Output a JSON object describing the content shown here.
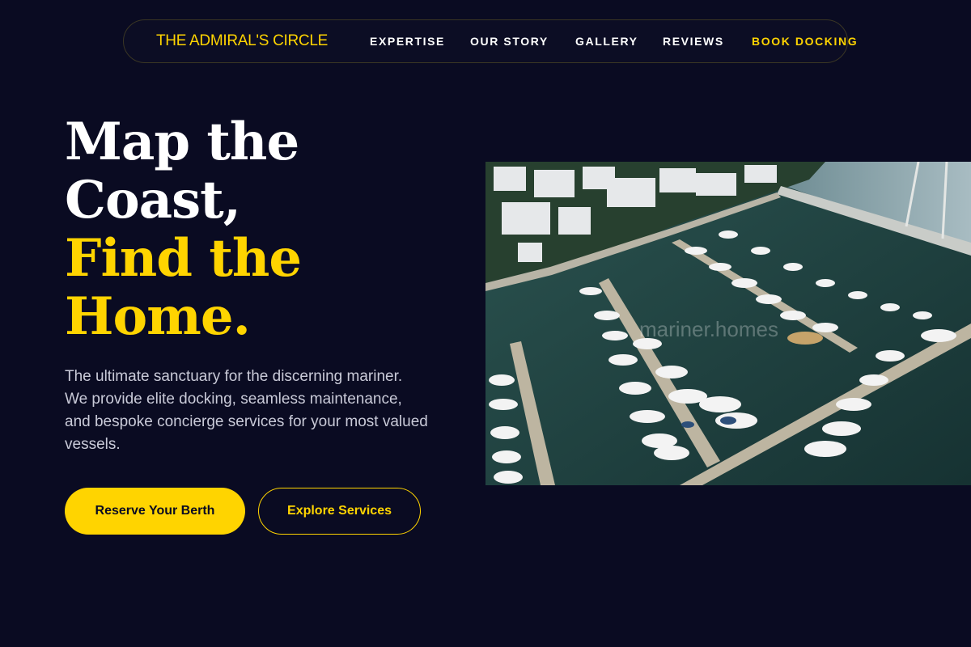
{
  "brand": {
    "name": "THE ADMIRAL'S CIRCLE"
  },
  "nav": {
    "links": [
      {
        "label": "EXPERTISE"
      },
      {
        "label": "OUR STORY"
      },
      {
        "label": "GALLERY"
      },
      {
        "label": "REVIEWS"
      },
      {
        "label": "BOOK DOCKING"
      }
    ]
  },
  "hero": {
    "title_lines": [
      "Map the",
      "Coast,",
      "Find the",
      "Home."
    ],
    "description": "The ultimate sanctuary for the discerning mariner. We provide elite docking, seamless maintenance, and bespoke concierge services for your most valued vessels.",
    "primary_cta": "Reserve Your Berth",
    "secondary_cta": "Explore Services"
  },
  "image": {
    "watermark": "mariner.homes"
  },
  "colors": {
    "background": "#0a0b22",
    "accent": "#ffd400",
    "text": "#ffffff",
    "muted": "#c9cad8"
  }
}
